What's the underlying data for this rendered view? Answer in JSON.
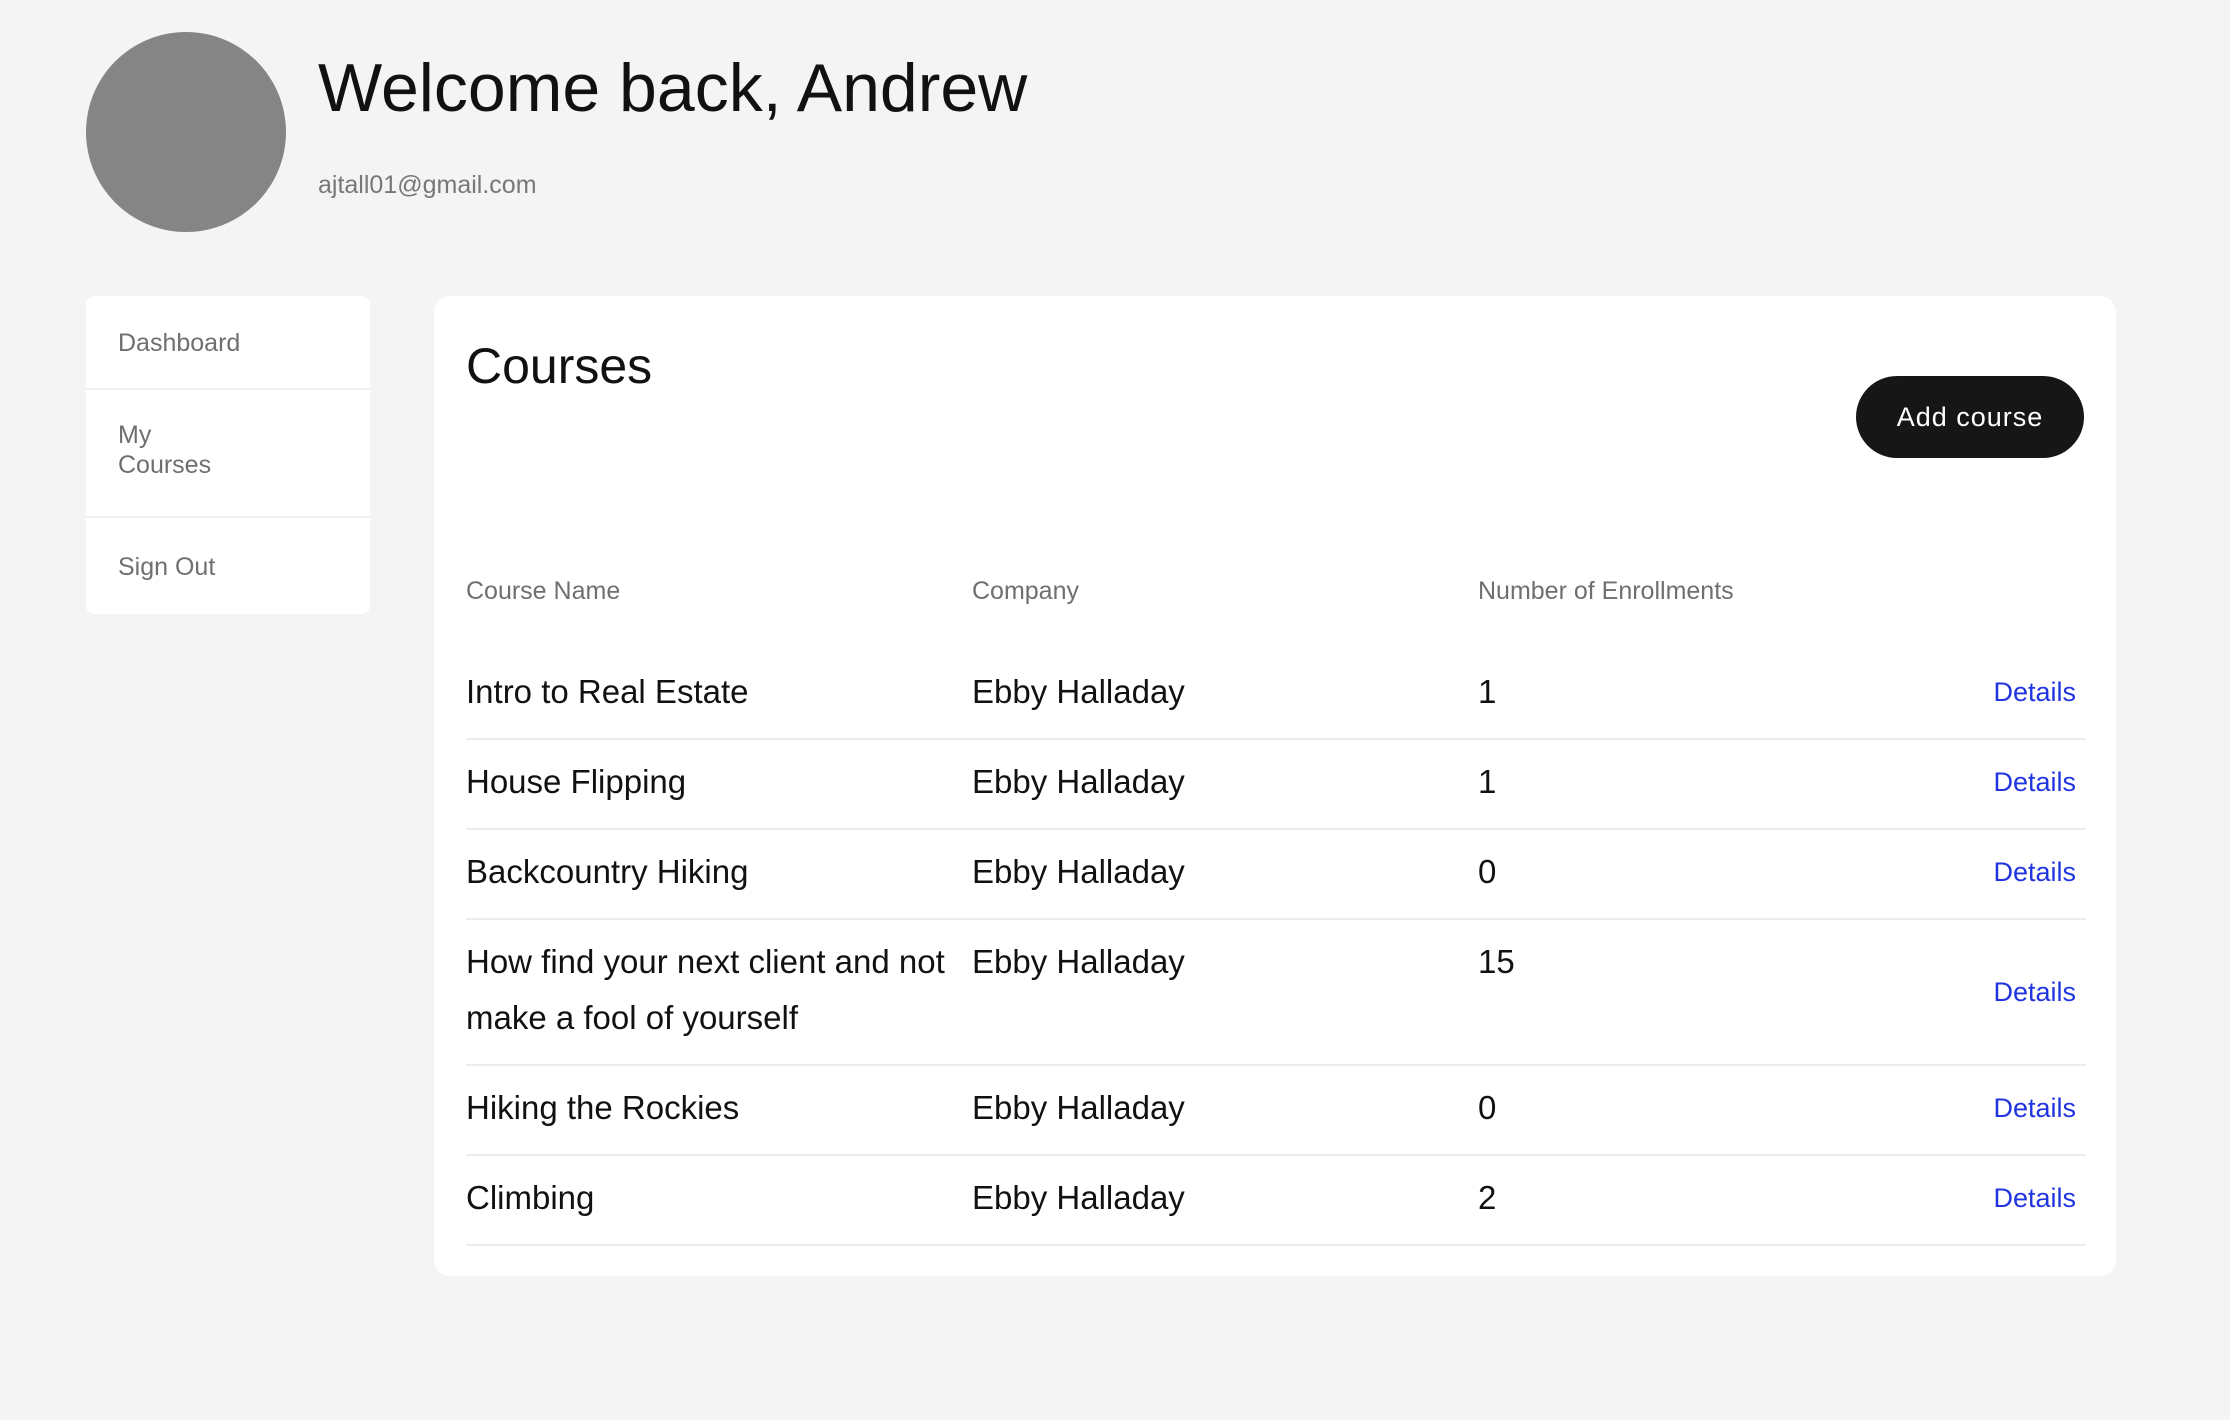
{
  "profile": {
    "welcome": "Welcome back, Andrew",
    "email": "ajtall01@gmail.com"
  },
  "sidebar": {
    "items": [
      {
        "label": "Dashboard"
      },
      {
        "label": "My\nCourses"
      },
      {
        "label": "Sign Out"
      }
    ]
  },
  "courses": {
    "title": "Courses",
    "add_button": "Add course",
    "columns": [
      "Course Name",
      "Company",
      "Number of Enrollments"
    ],
    "rows": [
      {
        "name": "Intro to Real Estate",
        "company": "Ebby Halladay",
        "enrollments": "1",
        "action": "Details"
      },
      {
        "name": "House Flipping",
        "company": "Ebby Halladay",
        "enrollments": "1",
        "action": "Details"
      },
      {
        "name": "Backcountry Hiking",
        "company": "Ebby Halladay",
        "enrollments": "0",
        "action": "Details"
      },
      {
        "name": "How find your next client and not make a fool of yourself",
        "company": "Ebby Halladay",
        "enrollments": "15",
        "action": "Details"
      },
      {
        "name": "Hiking the Rockies",
        "company": "Ebby Halladay",
        "enrollments": "0",
        "action": "Details"
      },
      {
        "name": "Climbing",
        "company": "Ebby Halladay",
        "enrollments": "2",
        "action": "Details"
      }
    ]
  },
  "colors": {
    "background": "#f4f4f4",
    "avatar": "#858585",
    "button": "#161616",
    "link": "#2034e0"
  }
}
